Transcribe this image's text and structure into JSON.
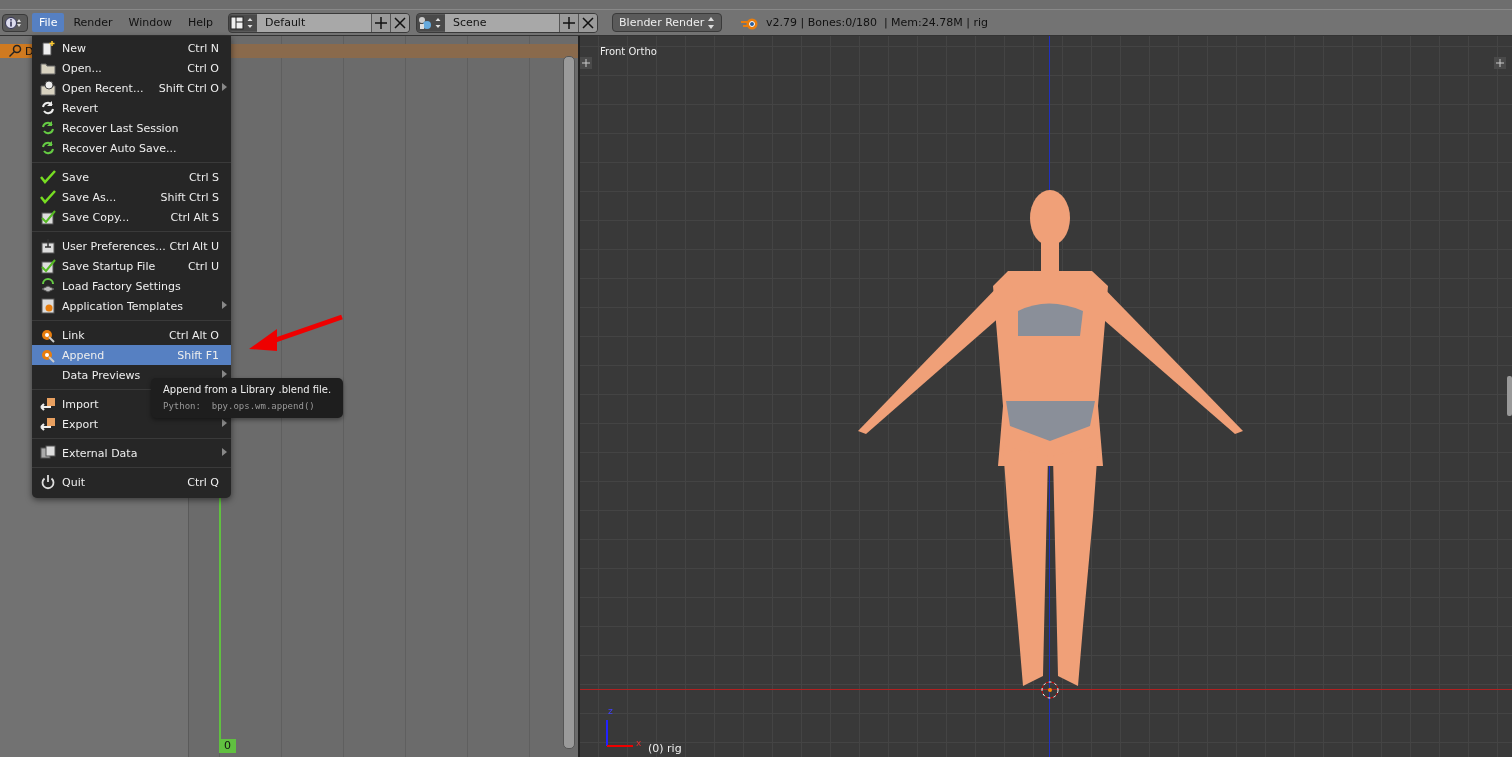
{
  "header": {
    "menus": [
      {
        "label": "File",
        "selected": true
      },
      {
        "label": "Render",
        "selected": false
      },
      {
        "label": "Window",
        "selected": false
      },
      {
        "label": "Help",
        "selected": false
      }
    ],
    "layout": {
      "value": "Default"
    },
    "scene": {
      "value": "Scene"
    },
    "engine": {
      "value": "Blender Render"
    },
    "stats": "v2.79 | Bones:0/180  | Mem:24.78M | rig"
  },
  "dope_sheet": {
    "summary_label": "D",
    "current_frame": "0"
  },
  "file_menu": {
    "sections": [
      [
        {
          "label": "New",
          "shortcut": "Ctrl N",
          "kind": "new",
          "submenu": false,
          "selected": false
        },
        {
          "label": "Open...",
          "shortcut": "Ctrl O",
          "kind": "folder",
          "submenu": false,
          "selected": false
        },
        {
          "label": "Open Recent...",
          "shortcut": "Shift Ctrl O",
          "kind": "recent",
          "submenu": true,
          "selected": false
        },
        {
          "label": "Revert",
          "kind": "revert",
          "submenu": false,
          "selected": false
        },
        {
          "label": "Recover Last Session",
          "kind": "recover",
          "submenu": false,
          "selected": false
        },
        {
          "label": "Recover Auto Save...",
          "kind": "recover",
          "submenu": false,
          "selected": false
        }
      ],
      [
        {
          "label": "Save",
          "shortcut": "Ctrl S",
          "kind": "check",
          "submenu": false,
          "selected": false
        },
        {
          "label": "Save As...",
          "shortcut": "Shift Ctrl S",
          "kind": "check",
          "submenu": false,
          "selected": false
        },
        {
          "label": "Save Copy...",
          "shortcut": "Ctrl Alt S",
          "kind": "checkbox",
          "submenu": false,
          "selected": false
        }
      ],
      [
        {
          "label": "User Preferences...",
          "shortcut": "Ctrl Alt U",
          "kind": "prefs",
          "submenu": false,
          "selected": false
        },
        {
          "label": "Save Startup File",
          "shortcut": "Ctrl U",
          "kind": "checkbox",
          "submenu": false,
          "selected": false
        },
        {
          "label": "Load Factory Settings",
          "kind": "factory",
          "submenu": false,
          "selected": false
        },
        {
          "label": "Application Templates",
          "kind": "templates",
          "submenu": true,
          "selected": false
        }
      ],
      [
        {
          "label": "Link",
          "shortcut": "Ctrl Alt O",
          "kind": "link",
          "submenu": false,
          "selected": false
        },
        {
          "label": "Append",
          "shortcut": "Shift F1",
          "kind": "link",
          "submenu": false,
          "selected": true
        },
        {
          "label": "Data Previews",
          "kind": "plain",
          "submenu": true,
          "selected": false
        }
      ],
      [
        {
          "label": "Import",
          "kind": "import",
          "selected": false
        },
        {
          "label": "Export",
          "kind": "import",
          "submenu": true,
          "selected": false
        }
      ],
      [
        {
          "label": "External Data",
          "kind": "external",
          "submenu": true,
          "selected": false
        }
      ],
      [
        {
          "label": "Quit",
          "shortcut": "Ctrl Q",
          "kind": "power",
          "submenu": false,
          "selected": false
        }
      ]
    ]
  },
  "tooltip": {
    "title": "Append from a Library .blend file.",
    "python": "Python:  bpy.ops.wm.append()"
  },
  "viewport": {
    "view_label": "Front Ortho",
    "axis_z": "z",
    "axis_x": "x",
    "object_label": "(0) rig"
  }
}
